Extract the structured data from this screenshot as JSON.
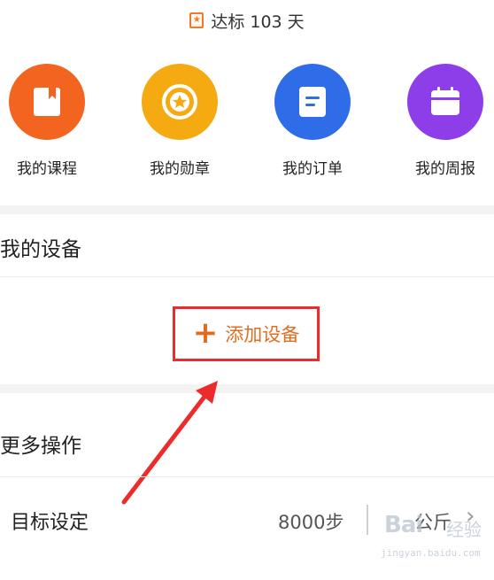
{
  "header": {
    "streak_text": "达标 103 天",
    "badge_icon": "star-badge-icon"
  },
  "quick_actions": [
    {
      "label": "我的课程",
      "icon": "book-icon",
      "color": "#f2641f"
    },
    {
      "label": "我的勋章",
      "icon": "medal-icon",
      "color": "#f6aa12"
    },
    {
      "label": "我的订单",
      "icon": "document-icon",
      "color": "#2f6de8"
    },
    {
      "label": "我的周报",
      "icon": "calendar-icon",
      "color": "#8e3ee8"
    }
  ],
  "devices": {
    "title": "我的设备",
    "add_label": "添加设备",
    "highlight_color": "#ec2c2c",
    "accent_color": "#e06d1f"
  },
  "more": {
    "title": "更多操作"
  },
  "goal": {
    "label": "目标设定",
    "steps": "8000步",
    "distance": "公斤",
    "chevron_icon": "chevron-right-icon"
  },
  "watermark": {
    "brand": "Bai",
    "brand_cn": "经验",
    "url": "jingyan.baidu.com"
  }
}
